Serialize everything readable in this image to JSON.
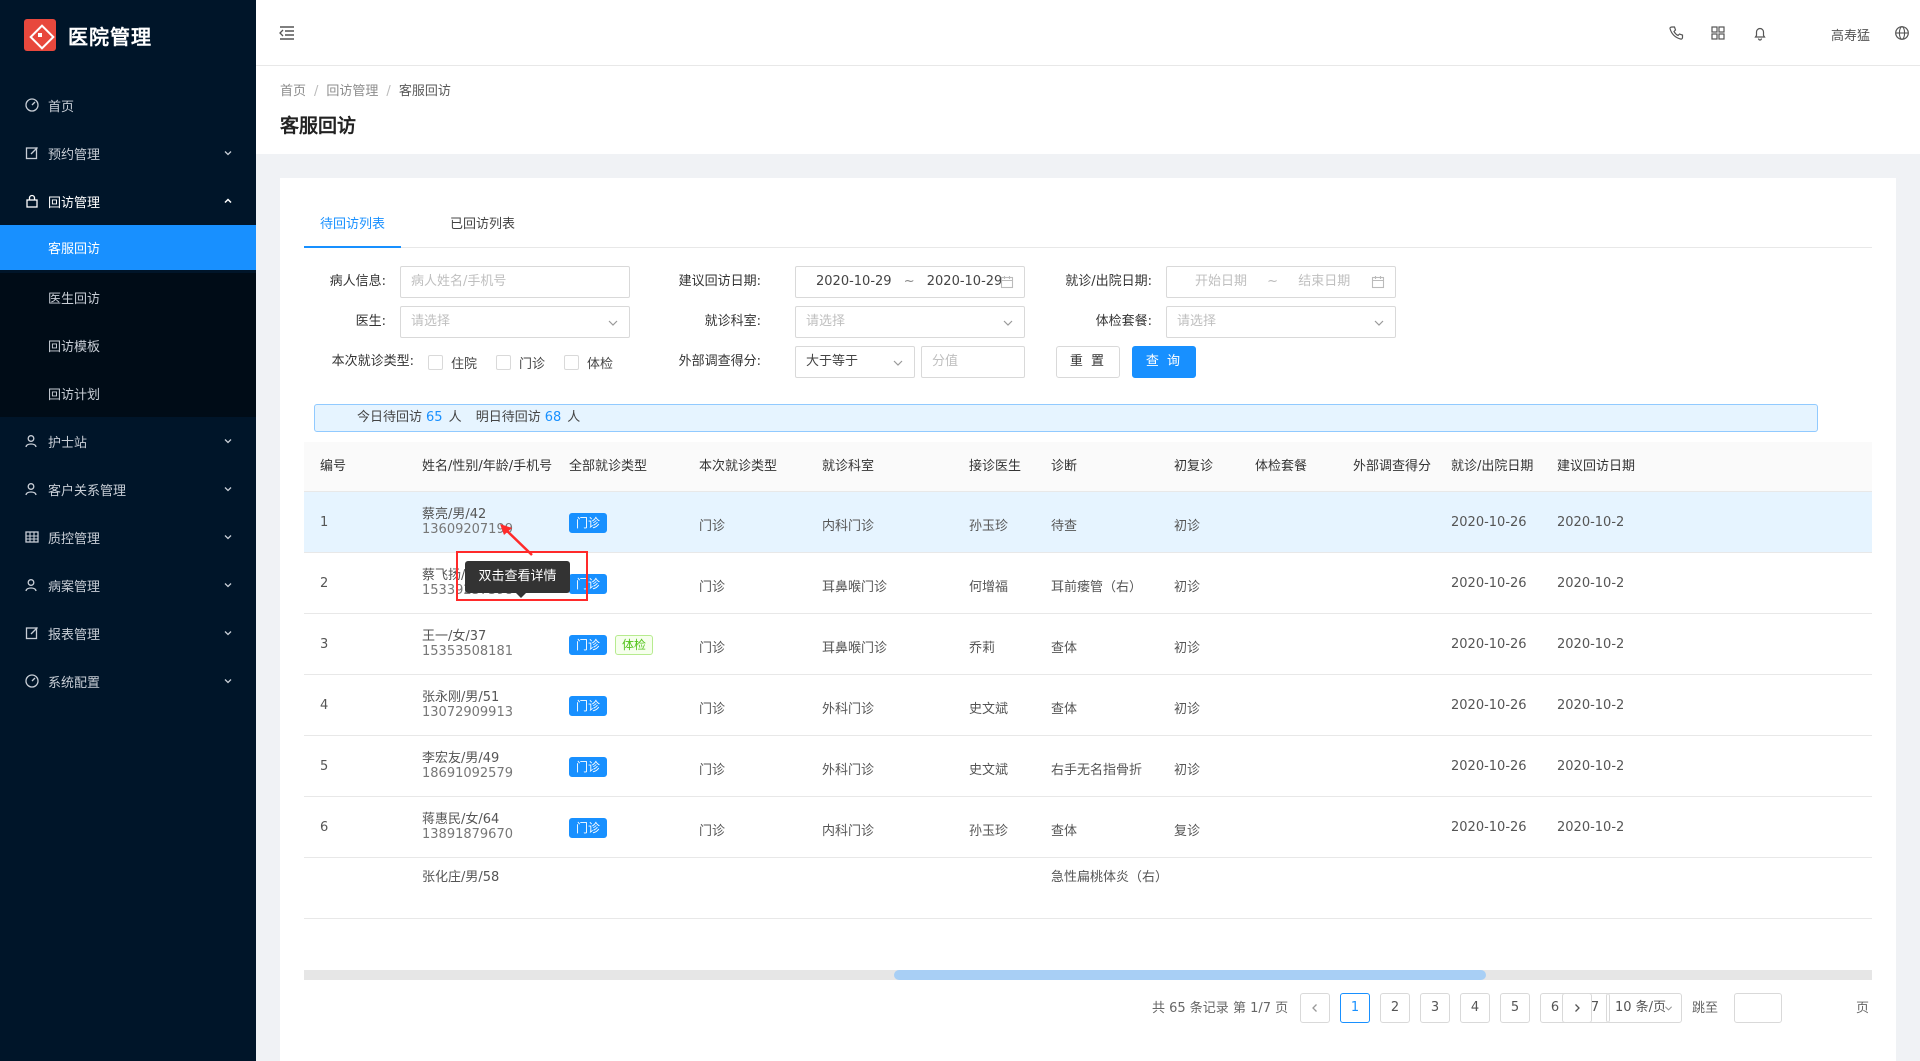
{
  "app": {
    "name": "医院管理"
  },
  "sidebar": {
    "items": [
      {
        "label": "首页",
        "icon": "dashboard-icon"
      },
      {
        "label": "预约管理",
        "icon": "edit-icon"
      },
      {
        "label": "回访管理",
        "icon": "lock-icon",
        "expanded": true
      },
      {
        "label": "客服回访",
        "active": true
      },
      {
        "label": "医生回访"
      },
      {
        "label": "回访模板"
      },
      {
        "label": "回访计划"
      },
      {
        "label": "护士站",
        "icon": "user-icon"
      },
      {
        "label": "客户关系管理",
        "icon": "user-icon"
      },
      {
        "label": "质控管理",
        "icon": "table-icon"
      },
      {
        "label": "病案管理",
        "icon": "user-icon"
      },
      {
        "label": "报表管理",
        "icon": "edit-icon"
      },
      {
        "label": "系统配置",
        "icon": "dashboard-icon"
      }
    ]
  },
  "header": {
    "username": "高寿猛"
  },
  "breadcrumb": {
    "items": [
      "首页",
      "回访管理",
      "客服回访"
    ]
  },
  "page": {
    "title": "客服回访"
  },
  "tabs": [
    "待回访列表",
    "已回访列表"
  ],
  "filters": {
    "patient_label": "病人信息:",
    "patient_placeholder": "病人姓名/手机号",
    "suggest_date_label": "建议回访日期:",
    "suggest_date_start": "2020-10-29",
    "suggest_date_end": "2020-10-29",
    "visit_date_label": "就诊/出院日期:",
    "visit_date_start_placeholder": "开始日期",
    "visit_date_end_placeholder": "结束日期",
    "doctor_label": "医生:",
    "doctor_placeholder": "请选择",
    "dept_label": "就诊科室:",
    "dept_placeholder": "请选择",
    "package_label": "体检套餐:",
    "package_placeholder": "请选择",
    "type_label": "本次就诊类型:",
    "type_options": [
      "住院",
      "门诊",
      "体检"
    ],
    "score_label": "外部调查得分:",
    "score_op": "大于等于",
    "score_placeholder": "分值",
    "reset": "重 置",
    "search": "查 询",
    "range_sep": "~"
  },
  "alert": {
    "today_label": "今日待回访",
    "today_count": "65",
    "tomorrow_label": "明日待回访",
    "tomorrow_count": "68",
    "unit": "人"
  },
  "table": {
    "columns": [
      "编号",
      "姓名/性别/年龄/手机号",
      "全部就诊类型",
      "本次就诊类型",
      "就诊科室",
      "接诊医生",
      "诊断",
      "初复诊",
      "体检套餐",
      "外部调查得分",
      "就诊/出院日期",
      "建议回访日期"
    ],
    "rows": [
      {
        "id": "1",
        "name": "蔡亮/男/42",
        "phone": "13609207199",
        "tags": [
          "门诊"
        ],
        "type": "门诊",
        "dept": "内科门诊",
        "doctor": "孙玉珍",
        "diagnosis": "待查",
        "visit": "初诊",
        "date": "2020-10-26",
        "suggest": "2020-10-2"
      },
      {
        "id": "2",
        "name": "蔡飞扬/女/17",
        "phone": "15339237398",
        "tags": [
          "门诊"
        ],
        "type": "门诊",
        "dept": "耳鼻喉门诊",
        "doctor": "何增福",
        "diagnosis": "耳前瘘管（右）",
        "visit": "初诊",
        "date": "2020-10-26",
        "suggest": "2020-10-2"
      },
      {
        "id": "3",
        "name": "王一/女/37",
        "phone": "15353508181",
        "tags": [
          "门诊",
          "体检"
        ],
        "type": "门诊",
        "dept": "耳鼻喉门诊",
        "doctor": "乔莉",
        "diagnosis": "查体",
        "visit": "初诊",
        "date": "2020-10-26",
        "suggest": "2020-10-2"
      },
      {
        "id": "4",
        "name": "张永刚/男/51",
        "phone": "13072909913",
        "tags": [
          "门诊"
        ],
        "type": "门诊",
        "dept": "外科门诊",
        "doctor": "史文斌",
        "diagnosis": "查体",
        "visit": "初诊",
        "date": "2020-10-26",
        "suggest": "2020-10-2"
      },
      {
        "id": "5",
        "name": "李宏友/男/49",
        "phone": "18691092579",
        "tags": [
          "门诊"
        ],
        "type": "门诊",
        "dept": "外科门诊",
        "doctor": "史文斌",
        "diagnosis": "右手无名指骨折",
        "visit": "初诊",
        "date": "2020-10-26",
        "suggest": "2020-10-2"
      },
      {
        "id": "6",
        "name": "蒋惠民/女/64",
        "phone": "13891879670",
        "tags": [
          "门诊"
        ],
        "type": "门诊",
        "dept": "内科门诊",
        "doctor": "孙玉珍",
        "diagnosis": "查体",
        "visit": "复诊",
        "date": "2020-10-26",
        "suggest": "2020-10-2"
      },
      {
        "id": "",
        "name": "张化庄/男/58",
        "phone": "",
        "tags": [],
        "type": "",
        "dept": "",
        "doctor": "",
        "diagnosis": "急性扁桃体炎（右）",
        "visit": "",
        "date": "",
        "suggest": ""
      }
    ]
  },
  "tooltip": {
    "text": "双击查看详情"
  },
  "pagination": {
    "total_text": "共 65 条记录 第 1/7 页",
    "pages": [
      "1",
      "2",
      "3",
      "4",
      "5",
      "6",
      "7"
    ],
    "current": "1",
    "page_size": "10 条/页",
    "jump_label": "跳至",
    "jump_unit": "页"
  },
  "colors": {
    "primary": "#1890ff",
    "sidebar_bg": "#001529",
    "highlight_row": "#e6f4ff",
    "annotation": "#ff2a2a"
  }
}
